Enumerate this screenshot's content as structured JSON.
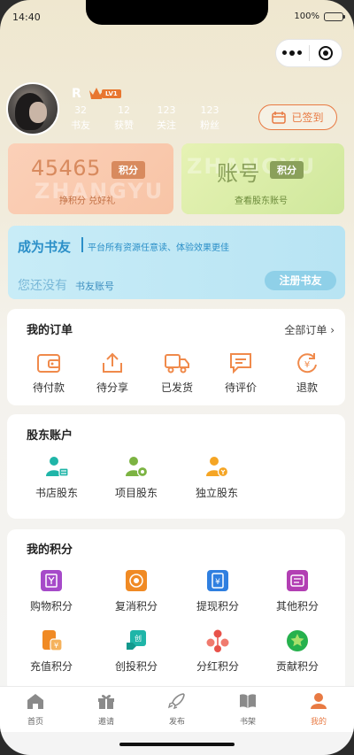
{
  "status": {
    "time": "14:40",
    "battery": "100%"
  },
  "profile": {
    "name": "R",
    "level": "LV1",
    "stats": [
      {
        "num": "32",
        "label": "书友"
      },
      {
        "num": "12",
        "label": "获赞"
      },
      {
        "num": "123",
        "label": "关注"
      },
      {
        "num": "123",
        "label": "粉丝"
      }
    ],
    "signin_label": "已签到"
  },
  "points_card": {
    "value": "45465",
    "tag": "积分",
    "sub": "挣积分 兑好礼"
  },
  "account_card": {
    "value": "账号",
    "tag": "积分",
    "sub": "查看股东账号"
  },
  "watermark": "ZHANGYU",
  "vip": {
    "title": "成为书友",
    "desc": "平台所有资源任意读、体验效果更佳",
    "no_account_a": "您还没有",
    "no_account_b": "书友账号",
    "button": "注册书友"
  },
  "orders": {
    "title": "我的订单",
    "all": "全部订单",
    "items": [
      {
        "label": "待付款",
        "icon": "wallet-icon"
      },
      {
        "label": "待分享",
        "icon": "share-icon"
      },
      {
        "label": "已发货",
        "icon": "truck-icon"
      },
      {
        "label": "待评价",
        "icon": "comment-icon"
      },
      {
        "label": "退款",
        "icon": "refund-icon"
      }
    ]
  },
  "shareholder": {
    "title": "股东账户",
    "items": [
      {
        "label": "书店股东",
        "icon": "bookstore-shareholder-icon"
      },
      {
        "label": "项目股东",
        "icon": "project-shareholder-icon"
      },
      {
        "label": "独立股东",
        "icon": "independent-shareholder-icon"
      }
    ]
  },
  "my_points": {
    "title": "我的积分",
    "items": [
      {
        "label": "购物积分",
        "icon": "shopping-points-icon",
        "color": "#a64ac9"
      },
      {
        "label": "复消积分",
        "icon": "repurchase-points-icon",
        "color": "#f08a24"
      },
      {
        "label": "提现积分",
        "icon": "withdraw-points-icon",
        "color": "#2f7fe0"
      },
      {
        "label": "其他积分",
        "icon": "other-points-icon",
        "color": "#b23fb3"
      },
      {
        "label": "充值积分",
        "icon": "recharge-points-icon",
        "color": "#f08a24"
      },
      {
        "label": "创投积分",
        "icon": "venture-points-icon",
        "color": "#1fb5a8"
      },
      {
        "label": "分红积分",
        "icon": "dividend-points-icon",
        "color": "#e8524a"
      },
      {
        "label": "贡献积分",
        "icon": "contribution-points-icon",
        "color": "#26b14d"
      }
    ]
  },
  "tabs": [
    {
      "label": "首页",
      "icon": "home-icon"
    },
    {
      "label": "邀请",
      "icon": "gift-icon"
    },
    {
      "label": "发布",
      "icon": "rocket-icon"
    },
    {
      "label": "书架",
      "icon": "book-icon"
    },
    {
      "label": "我的",
      "icon": "person-icon"
    }
  ],
  "colors": {
    "accent": "#e87a43",
    "vip_blue": "#2b8fc8"
  }
}
